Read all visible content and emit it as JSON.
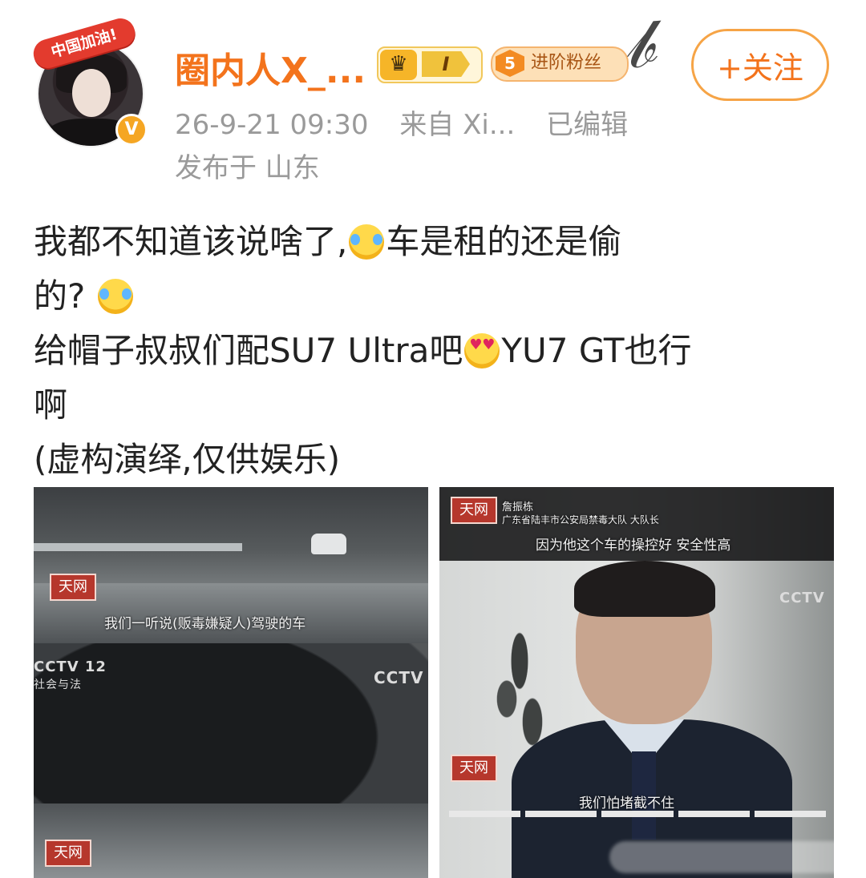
{
  "header": {
    "avatar_banner": "中国加油!",
    "verify_mark": "V",
    "username": "圈内人X_...",
    "level_badge_icon": "crown-icon",
    "level_badge_value": "I",
    "fan_badge_level": "5",
    "fan_badge_label": "进阶粉丝",
    "follow_button": "+关注",
    "timestamp": "26-9-21 09:30",
    "source": "来自 Xi...",
    "edited": "已编辑",
    "location": "发布于 山东"
  },
  "post": {
    "line1_a": "我都不知道该说啥了,",
    "line1_b": "车是租的还是偷",
    "line2": "的?",
    "line3_a": "给帽子叔叔们配SU7 Ultra吧",
    "line3_b": "YU7 GT也行",
    "line4": "啊",
    "line5": "(虚构演绎,仅供娱乐)"
  },
  "images": {
    "left": {
      "logo_top": "天网",
      "subtitle_top": "我们一听说(贩毒嫌疑人)驾驶的车",
      "channel": "CCTV 12",
      "channel_sub": "社会与法",
      "cctv_logo": "CCTV",
      "logo_bottom": "天网"
    },
    "right": {
      "logo_top": "天网",
      "name_caption": "詹振栋",
      "title_caption": "广东省陆丰市公安局禁毒大队 大队长",
      "subtitle_top": "因为他这个车的操控好 安全性高",
      "cctv_logo": "CCTV",
      "logo_bottom": "天网",
      "subtitle_bottom": "我们怕堵截不住"
    }
  },
  "icons": {
    "emoji_laugh": "laughing-crying-emoji",
    "emoji_heart_eyes": "heart-eyes-emoji"
  },
  "colors": {
    "username": "#f3731c",
    "follow": "#f3731c",
    "meta": "#9a9a9a"
  }
}
